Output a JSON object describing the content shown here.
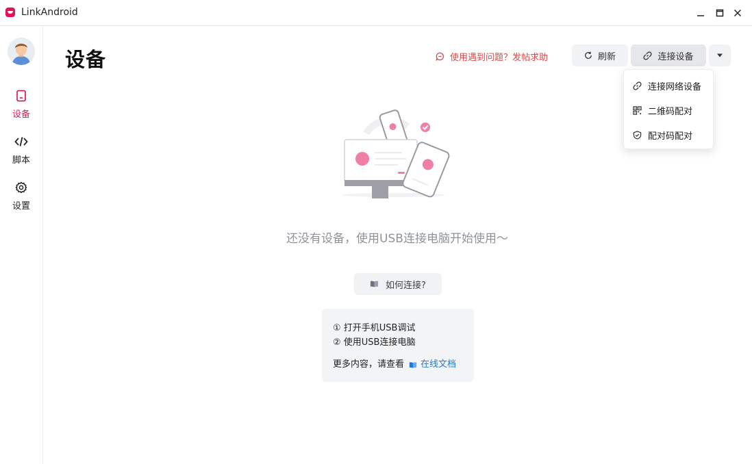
{
  "window": {
    "title": "LinkAndroid"
  },
  "sidebar": {
    "items": [
      {
        "label": "设备",
        "icon": "device-icon",
        "active": true
      },
      {
        "label": "脚本",
        "icon": "code-icon",
        "active": false
      },
      {
        "label": "设置",
        "icon": "gear-icon",
        "active": false
      }
    ]
  },
  "header": {
    "title": "设备",
    "help_link": "使用遇到问题？发帖求助",
    "refresh_label": "刷新",
    "connect_label": "连接设备"
  },
  "connect_menu": {
    "items": [
      {
        "label": "连接网络设备",
        "icon": "link-icon"
      },
      {
        "label": "二维码配对",
        "icon": "qrcode-icon"
      },
      {
        "label": "配对码配对",
        "icon": "shield-icon"
      }
    ]
  },
  "empty_state": {
    "message": "还没有设备，使用USB连接电脑开始使用～",
    "how_button": "如何连接?",
    "steps": [
      "① 打开手机USB调试",
      "② 使用USB连接电脑"
    ],
    "more_text": "更多内容，请查看",
    "doc_link": "在线文档"
  },
  "colors": {
    "accent": "#d81b60",
    "help_link": "#d94848",
    "doc_link": "#1e7bd8"
  }
}
